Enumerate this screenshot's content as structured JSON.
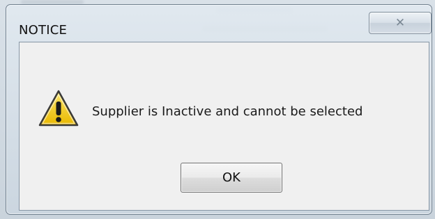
{
  "dialog": {
    "title": "NOTICE",
    "message": "Supplier is Inactive and cannot be selected",
    "icon": "warning-icon",
    "close_icon": "close-icon",
    "close_glyph": "✕",
    "ok_label": "OK"
  },
  "colors": {
    "warning_fill": "#f5d21b",
    "warning_outline": "#3a3a3a",
    "client_background": "#f0f0f0"
  }
}
